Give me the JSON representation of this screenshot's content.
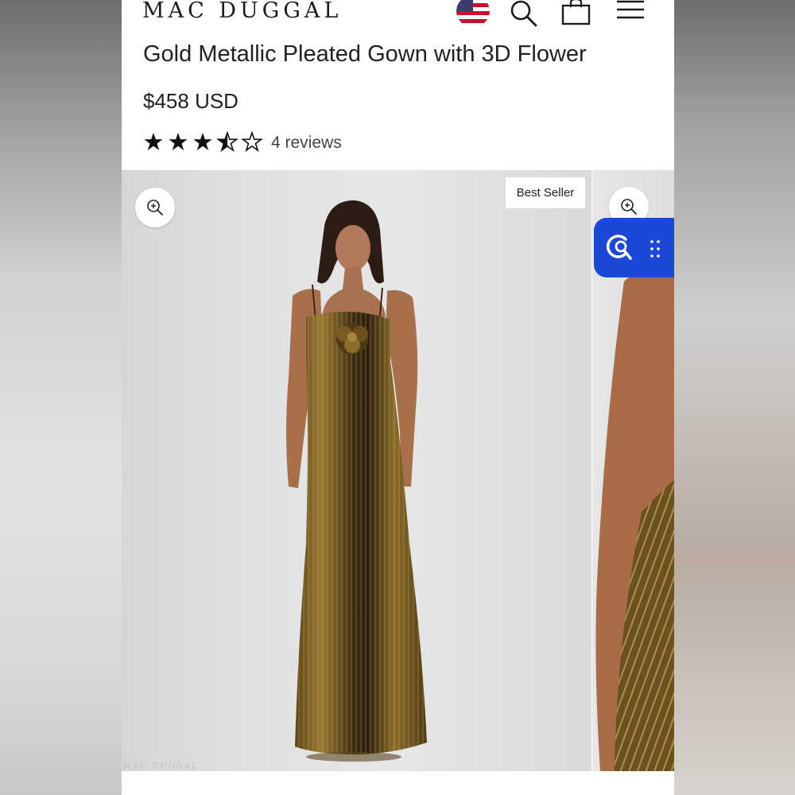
{
  "brand": {
    "name": "MAC DUGGAL"
  },
  "header": {
    "icons": [
      "us-flag-icon",
      "search-icon",
      "shopping-bag-icon",
      "hamburger-menu-icon"
    ]
  },
  "product": {
    "title": "Gold Metallic Pleated Gown with 3D Flower",
    "price": "$458 USD",
    "rating": 3.5,
    "rating_max": 5,
    "reviews_label": "4 reviews"
  },
  "gallery": {
    "badge": "Best Seller",
    "watermark": "MAC DUGGAL",
    "widget_icon": "visual-search-icon"
  },
  "colors": {
    "widget_blue": "#1d47d6",
    "gown_gold": "#8a6a2a",
    "text": "#222222"
  }
}
